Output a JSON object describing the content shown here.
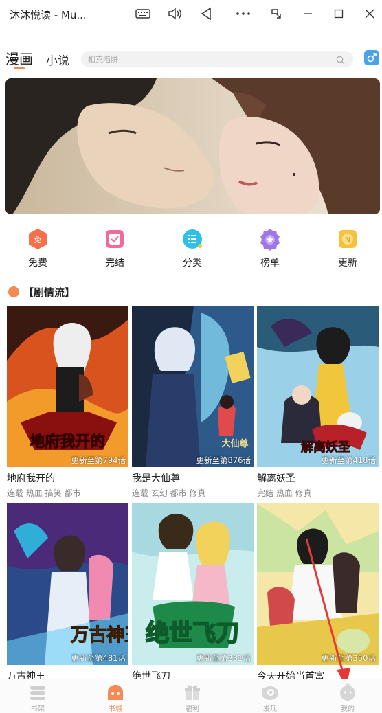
{
  "window": {
    "title": "沐沐悦读 - Mu...",
    "buttons": [
      "keyboard-icon",
      "volume-icon",
      "back-icon",
      "more-icon",
      "screen-icon",
      "minimize-icon",
      "maximize-icon",
      "close-icon"
    ]
  },
  "topnav": {
    "tabs": [
      {
        "label": "漫画",
        "active": true
      },
      {
        "label": "小说",
        "active": false
      }
    ],
    "search_placeholder": "相克陷阱",
    "gender_icon": "male-icon"
  },
  "categories": [
    {
      "label": "免费",
      "icon": "free-icon",
      "badge": "免",
      "color": "#f56f4b"
    },
    {
      "label": "完结",
      "icon": "finished-icon",
      "color": "#f06a9a"
    },
    {
      "label": "分类",
      "icon": "category-icon",
      "color": "#2ec0e8"
    },
    {
      "label": "榜单",
      "icon": "ranking-icon",
      "color": "#a176e8"
    },
    {
      "label": "更新",
      "icon": "update-icon",
      "badge": "N",
      "color": "#f5c23b"
    }
  ],
  "section": {
    "title": "【剧情流】"
  },
  "comics": [
    {
      "title": "地府我开的",
      "tags": "连载 热血 搞笑 都市",
      "update": "更新至第794话",
      "cover_text": "地府我开的"
    },
    {
      "title": "我是大仙尊",
      "tags": "连载 玄幻 都市 修真",
      "update": "更新至第876话",
      "cover_text": "大仙尊"
    },
    {
      "title": "解离妖圣",
      "tags": "完结 热血 修真",
      "update": "更新至第418话",
      "cover_text": "解离妖圣"
    },
    {
      "title": "万古神王",
      "tags": "",
      "update": "更新至第481话",
      "cover_text": "万古神王"
    },
    {
      "title": "绝世飞刀",
      "tags": "",
      "update": "更新至第281话",
      "cover_text": "绝世飞刀"
    },
    {
      "title": "今天开始当首富",
      "tags": "",
      "update": "更新至第350话",
      "cover_text": ""
    }
  ],
  "bottomnav": [
    {
      "label": "书架",
      "icon": "bookshelf-icon",
      "active": false
    },
    {
      "label": "书城",
      "icon": "bookstore-icon",
      "active": true
    },
    {
      "label": "福利",
      "icon": "gift-icon",
      "active": false
    },
    {
      "label": "发现",
      "icon": "discover-icon",
      "active": false
    },
    {
      "label": "我的",
      "icon": "profile-icon",
      "active": false
    }
  ],
  "colors": {
    "accent": "#f58a55",
    "male": "#4aa3e8",
    "annotation": "#e53935"
  }
}
